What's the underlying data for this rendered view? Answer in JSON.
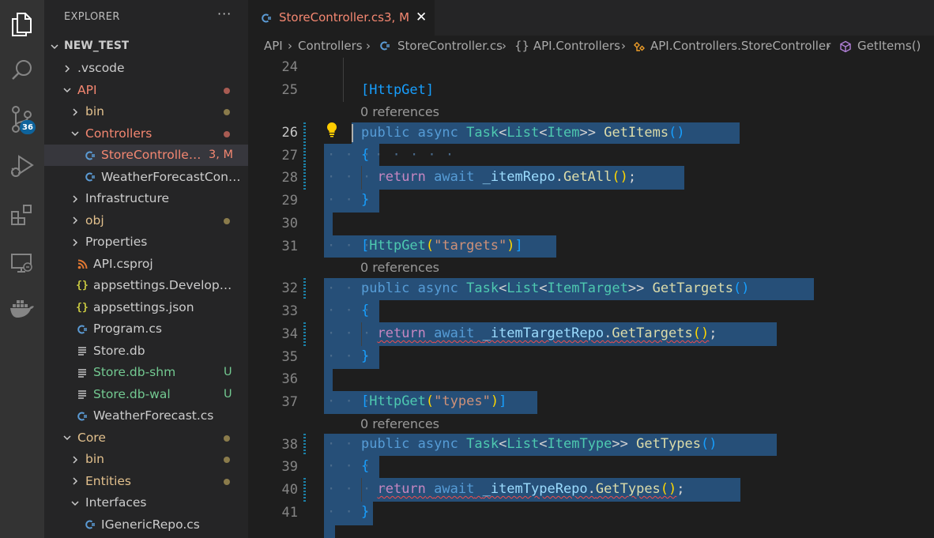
{
  "activity_bar": {
    "items": [
      {
        "name": "explorer-icon",
        "active": true
      },
      {
        "name": "search-icon"
      },
      {
        "name": "source-control-icon",
        "badge": "36"
      },
      {
        "name": "run-debug-icon"
      },
      {
        "name": "extensions-icon"
      },
      {
        "name": "remote-explorer-icon"
      },
      {
        "name": "docker-icon"
      }
    ]
  },
  "sidebar": {
    "title": "EXPLORER",
    "more": "···",
    "root": "NEW_TEST",
    "tree": [
      {
        "label": ".vscode",
        "type": "folder",
        "collapsed": true,
        "depth": 1,
        "color": "#cccccc"
      },
      {
        "label": "API",
        "type": "folder",
        "collapsed": false,
        "depth": 1,
        "color": "#f48771",
        "dot": "red"
      },
      {
        "label": "bin",
        "type": "folder",
        "collapsed": true,
        "depth": 2,
        "color": "#e2c08d",
        "dot": "olive"
      },
      {
        "label": "Controllers",
        "type": "folder",
        "collapsed": false,
        "depth": 2,
        "color": "#f48771",
        "dot": "red"
      },
      {
        "label": "StoreController.cs",
        "type": "csharp",
        "depth": 3,
        "color": "#f48771",
        "status": "3, M",
        "selected": true
      },
      {
        "label": "WeatherForecastControll...",
        "type": "csharp",
        "depth": 3,
        "color": "#cccccc"
      },
      {
        "label": "Infrastructure",
        "type": "folder",
        "collapsed": true,
        "depth": 2,
        "color": "#cccccc"
      },
      {
        "label": "obj",
        "type": "folder",
        "collapsed": true,
        "depth": 2,
        "color": "#e2c08d",
        "dot": "olive"
      },
      {
        "label": "Properties",
        "type": "folder",
        "collapsed": true,
        "depth": 2,
        "color": "#cccccc"
      },
      {
        "label": "API.csproj",
        "type": "rss",
        "depth": 2,
        "color": "#cccccc"
      },
      {
        "label": "appsettings.Development.j...",
        "type": "json",
        "depth": 2,
        "color": "#cccccc"
      },
      {
        "label": "appsettings.json",
        "type": "json",
        "depth": 2,
        "color": "#cccccc"
      },
      {
        "label": "Program.cs",
        "type": "csharp",
        "depth": 2,
        "color": "#cccccc"
      },
      {
        "label": "Store.db",
        "type": "lines",
        "depth": 2,
        "color": "#cccccc"
      },
      {
        "label": "Store.db-shm",
        "type": "lines",
        "depth": 2,
        "color": "#73c991",
        "status": "U"
      },
      {
        "label": "Store.db-wal",
        "type": "lines",
        "depth": 2,
        "color": "#73c991",
        "status": "U"
      },
      {
        "label": "WeatherForecast.cs",
        "type": "csharp",
        "depth": 2,
        "color": "#cccccc"
      },
      {
        "label": "Core",
        "type": "folder",
        "collapsed": false,
        "depth": 1,
        "color": "#e2c08d",
        "dot": "olive"
      },
      {
        "label": "bin",
        "type": "folder",
        "collapsed": true,
        "depth": 2,
        "color": "#e2c08d",
        "dot": "olive"
      },
      {
        "label": "Entities",
        "type": "folder",
        "collapsed": true,
        "depth": 2,
        "color": "#e2c08d",
        "dot": "olive"
      },
      {
        "label": "Interfaces",
        "type": "folder",
        "collapsed": false,
        "depth": 2,
        "color": "#cccccc"
      },
      {
        "label": "IGenericRepo.cs",
        "type": "csharp",
        "depth": 3,
        "color": "#cccccc"
      }
    ]
  },
  "editor": {
    "tab": {
      "title": "StoreController.cs",
      "status": "3, M",
      "close": "✕"
    },
    "breadcrumbs": [
      "API",
      "Controllers",
      "StoreController.cs",
      "{} API.Controllers",
      "API.Controllers.StoreController",
      "GetItems()"
    ],
    "codelens": "0 references",
    "line_numbers": [
      "24",
      "25",
      "26",
      "27",
      "28",
      "29",
      "30",
      "31",
      "32",
      "33",
      "34",
      "35",
      "36",
      "37",
      "38",
      "39",
      "40",
      "41"
    ],
    "code": {
      "attr_httpget": "[HttpGet]",
      "attr_targets_open": "[HttpGet(",
      "attr_targets_str": "\"targets\"",
      "attr_types_str": "\"types\"",
      "kw_public": "public",
      "kw_async": "async",
      "kw_return": "return",
      "kw_await": "await",
      "ty_task": "Task",
      "ty_list": "List",
      "ty_item": "Item",
      "ty_itemtarget": "ItemTarget",
      "ty_itemtype": "ItemType",
      "fn_getitems": "GetItems",
      "fn_gettargets": "GetTargets",
      "fn_gettypes": "GetTypes",
      "fn_getall": "GetAll",
      "id_itemrepo": "_itemRepo",
      "id_itemtargetrepo": "_itemTargetRepo",
      "id_itemtyperepo": "_itemTypeRepo"
    }
  },
  "colors": {
    "activity_bar": "#333333",
    "sidebar": "#252526",
    "editor": "#1e1e1e",
    "selection": "#264f78",
    "modified": "#f48771",
    "untracked": "#73c991",
    "badge": "#0e639c"
  }
}
